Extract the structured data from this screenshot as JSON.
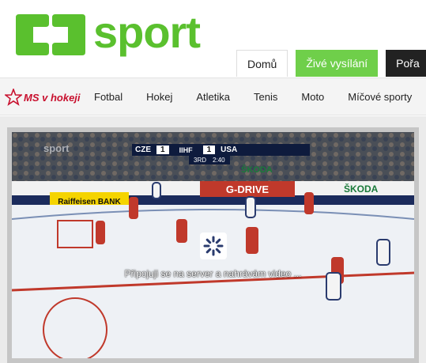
{
  "header": {
    "logo_text": "sport",
    "brand_color": "#5ac02e",
    "tabs": [
      {
        "label": "Domů",
        "active": true
      },
      {
        "label": "Živé vysílání",
        "accent": "#6fcf4a"
      },
      {
        "label": "Pořa"
      }
    ]
  },
  "nav": {
    "brand_label": "MS v hokeji",
    "brand_color": "#c8102e",
    "items": [
      "Fotbal",
      "Hokej",
      "Atletika",
      "Tenis",
      "Moto",
      "Míčové sporty"
    ]
  },
  "player": {
    "loading_text": "Připojuji se na server a nahrávám video ...",
    "watermark": "sport",
    "scoreboard": {
      "home_team": "CZE",
      "home_score": "1",
      "league": "IIHF",
      "away_score": "1",
      "away_team": "USA",
      "period": "3RD",
      "clock": "2:40"
    },
    "ads": [
      "ŠKODA",
      "G-DRIVE",
      "Raiffeisen BANK",
      "ŠKODA"
    ]
  }
}
